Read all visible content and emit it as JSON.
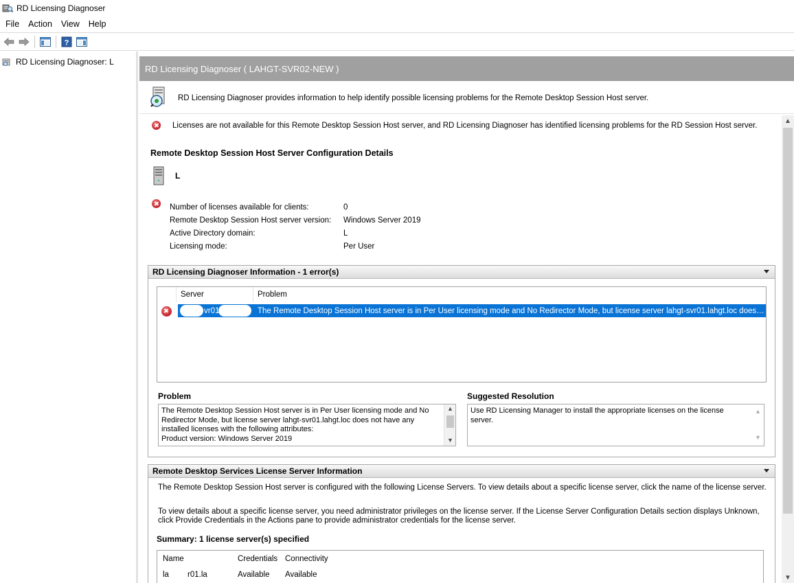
{
  "window": {
    "title": "RD Licensing Diagnoser"
  },
  "menu": {
    "items": [
      "File",
      "Action",
      "View",
      "Help"
    ]
  },
  "toolbar": {
    "icons": [
      "back-arrow-icon",
      "forward-arrow-icon",
      "show-hide-console-tree-icon",
      "help-icon",
      "show-hide-action-pane-icon"
    ]
  },
  "tree": {
    "root_label": "RD Licensing Diagnoser: L"
  },
  "main": {
    "header": "RD Licensing Diagnoser ( LAHGT-SVR02-NEW )",
    "intro": "RD Licensing Diagnoser provides information to help identify possible licensing problems for the Remote Desktop Session Host server.",
    "status": "Licenses are not available for this Remote Desktop Session Host server, and RD Licensing Diagnoser has identified licensing problems for the RD Session Host server.",
    "config_title": "Remote Desktop Session Host Server Configuration Details",
    "server_name": "L",
    "details": [
      {
        "label": "Number of licenses available for clients:",
        "value": "0"
      },
      {
        "label": "Remote Desktop Session Host server version:",
        "value": "Windows Server 2019"
      },
      {
        "label": "Active Directory domain:",
        "value": "L"
      },
      {
        "label": "Licensing mode:",
        "value": "Per User"
      }
    ]
  },
  "diag_section": {
    "title": "RD Licensing Diagnoser Information - 1 error(s)",
    "columns": {
      "server": "Server",
      "problem": "Problem"
    },
    "row": {
      "server": "vr01",
      "problem": "The Remote Desktop Session Host server is in Per User licensing mode and No Redirector Mode, but license server lahgt-svr01.lahgt.loc does no..."
    },
    "problem_title": "Problem",
    "problem_lines": [
      "The Remote Desktop Session Host server is in Per User licensing mode and No",
      "Redirector Mode, but license server lahgt-svr01.lahgt.loc does not have any",
      "installed licenses with the following attributes:",
      "Product version: Windows Server 2019"
    ],
    "resolution_title": "Suggested Resolution",
    "resolution_lines": [
      "Use RD Licensing Manager to install the appropriate licenses on the license",
      "server."
    ]
  },
  "ls_section": {
    "title": "Remote Desktop Services License Server Information",
    "text1": "The Remote Desktop Session Host server is configured with the following License Servers. To view details about a specific license server, click the name of the license server.",
    "text2_lines": [
      "To view details about a specific license server, you need administrator privileges on the license server. If the License Server Configuration Details section displays Unknown,",
      "click Provide Credentials in the Actions pane to provide administrator credentials for the license server."
    ],
    "summary": "Summary: 1 license server(s) specified",
    "columns": {
      "name": "Name",
      "credentials": "Credentials",
      "connectivity": "Connectivity"
    },
    "row": {
      "name": "la",
      "name2": "r01.la",
      "credentials": "Available",
      "connectivity": "Available"
    }
  }
}
